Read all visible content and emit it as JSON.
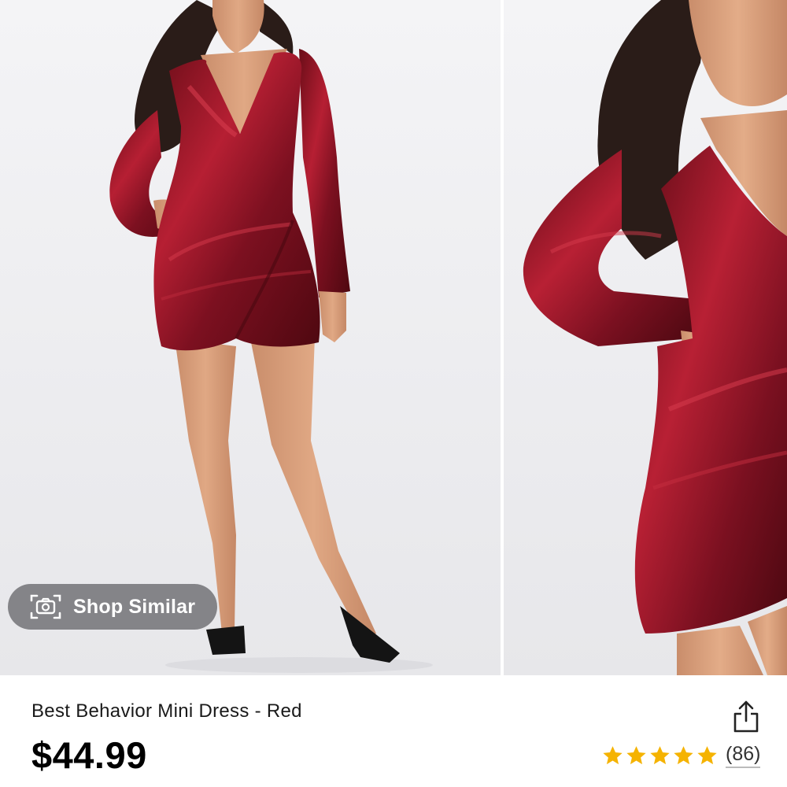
{
  "gallery": {
    "images": [
      {
        "icon": "product-photo-full-length"
      },
      {
        "icon": "product-photo-detail"
      }
    ],
    "shop_similar": {
      "label": "Shop Similar",
      "icon": "camera-icon"
    }
  },
  "product": {
    "title": "Best Behavior Mini Dress - Red",
    "price": "$44.99",
    "share_icon": "share-icon",
    "rating": {
      "stars": 5,
      "review_count": "(86)",
      "star_color": "#f5b301"
    }
  },
  "colors": {
    "dress": "#8c1524",
    "background": "#ffffff",
    "pill": "#6e6e72"
  }
}
